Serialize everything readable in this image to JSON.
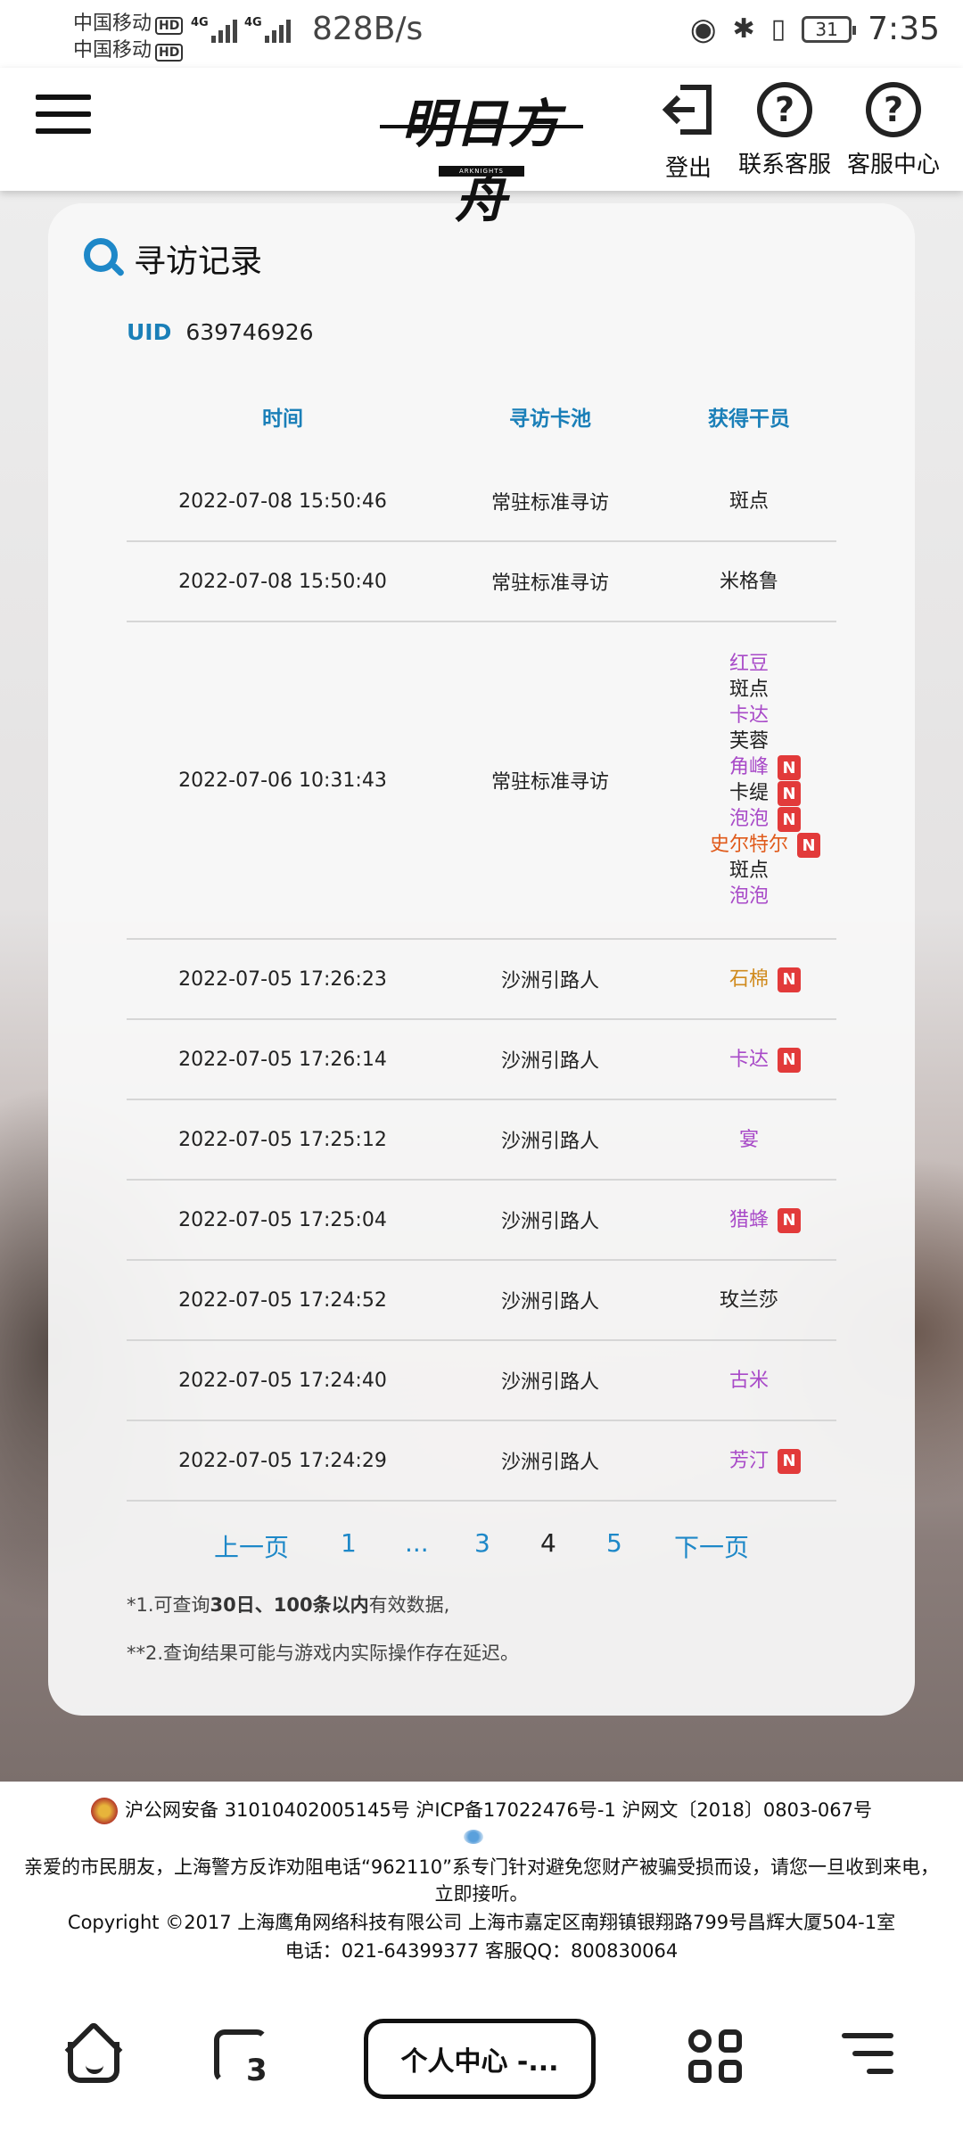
{
  "status_bar": {
    "carrier1": "中国移动",
    "carrier2": "中国移动",
    "hd_badge": "HD",
    "network_type": "4G",
    "net_speed": "828B/s",
    "battery": "31",
    "time": "7:35",
    "icons": [
      "signal-icon",
      "eye-icon",
      "bluetooth-icon",
      "vibrate-icon",
      "battery-icon"
    ]
  },
  "header": {
    "logo_text": "明日方舟",
    "logo_sub": "ARKNIGHTS",
    "actions": [
      {
        "label": "登出",
        "icon": "logout-icon"
      },
      {
        "label": "联系客服",
        "icon": "help-icon"
      },
      {
        "label": "客服中心",
        "icon": "help-icon"
      }
    ]
  },
  "card": {
    "title": "寻访记录",
    "uid_label": "UID",
    "uid_value": "639746926",
    "columns": [
      "时间",
      "寻访卡池",
      "获得干员"
    ],
    "rows": [
      {
        "time": "2022-07-08 15:50:46",
        "pool": "常驻标准寻访",
        "ops": [
          {
            "name": "斑点",
            "rarity": 3,
            "new": false
          }
        ]
      },
      {
        "time": "2022-07-08 15:50:40",
        "pool": "常驻标准寻访",
        "ops": [
          {
            "name": "米格鲁",
            "rarity": 3,
            "new": false
          }
        ]
      },
      {
        "time": "2022-07-06 10:31:43",
        "pool": "常驻标准寻访",
        "ops": [
          {
            "name": "红豆",
            "rarity": 4,
            "new": false
          },
          {
            "name": "斑点",
            "rarity": 3,
            "new": false
          },
          {
            "name": "卡达",
            "rarity": 4,
            "new": false
          },
          {
            "name": "芙蓉",
            "rarity": 3,
            "new": false
          },
          {
            "name": "角峰",
            "rarity": 4,
            "new": true
          },
          {
            "name": "卡缇",
            "rarity": 3,
            "new": true
          },
          {
            "name": "泡泡",
            "rarity": 4,
            "new": true
          },
          {
            "name": "史尔特尔",
            "rarity": 6,
            "new": true
          },
          {
            "name": "斑点",
            "rarity": 3,
            "new": false
          },
          {
            "name": "泡泡",
            "rarity": 4,
            "new": false
          }
        ]
      },
      {
        "time": "2022-07-05 17:26:23",
        "pool": "沙洲引路人",
        "ops": [
          {
            "name": "石棉",
            "rarity": 5,
            "new": true
          }
        ]
      },
      {
        "time": "2022-07-05 17:26:14",
        "pool": "沙洲引路人",
        "ops": [
          {
            "name": "卡达",
            "rarity": 4,
            "new": true
          }
        ]
      },
      {
        "time": "2022-07-05 17:25:12",
        "pool": "沙洲引路人",
        "ops": [
          {
            "name": "宴",
            "rarity": 4,
            "new": false
          }
        ]
      },
      {
        "time": "2022-07-05 17:25:04",
        "pool": "沙洲引路人",
        "ops": [
          {
            "name": "猎蜂",
            "rarity": 4,
            "new": true
          }
        ]
      },
      {
        "time": "2022-07-05 17:24:52",
        "pool": "沙洲引路人",
        "ops": [
          {
            "name": "玫兰莎",
            "rarity": 3,
            "new": false
          }
        ]
      },
      {
        "time": "2022-07-05 17:24:40",
        "pool": "沙洲引路人",
        "ops": [
          {
            "name": "古米",
            "rarity": 4,
            "new": false
          }
        ]
      },
      {
        "time": "2022-07-05 17:24:29",
        "pool": "沙洲引路人",
        "ops": [
          {
            "name": "芳汀",
            "rarity": 4,
            "new": true
          }
        ]
      }
    ],
    "new_badge": "N",
    "rarity_colors": {
      "3": "#222222",
      "4": "#a84ac8",
      "5": "#d08a1c",
      "6": "#e05a1a"
    },
    "pager": {
      "prev": "上一页",
      "pages": [
        "1",
        "...",
        "3",
        "4",
        "5"
      ],
      "current": "4",
      "next": "下一页"
    },
    "notes": {
      "note1_prefix": "*1.可查询",
      "note1_bold": "30日、100条以内",
      "note1_suffix": "有效数据,",
      "note2": "**2.查询结果可能与游戏内实际操作存在延迟。"
    }
  },
  "footer": {
    "line1": "沪公网安备 31010402005145号 沪ICP备17022476号-1 沪网文〔2018〕0803-067号",
    "line2": "亲爱的市民朋友，上海警方反诈劝阻电话“962110”系专门针对避免您财产被骗受损而设，请您一旦收到来电，",
    "line3": "立即接听。",
    "line4": "Copyright ©2017 上海鹰角网络科技有限公司 上海市嘉定区南翔镇银翔路799号昌辉大厦504-1室",
    "line5": "电话：021-64399377 客服QQ：800830064"
  },
  "bottom_nav": {
    "tabs_count": "3",
    "address_label": "个人中心 -..."
  }
}
